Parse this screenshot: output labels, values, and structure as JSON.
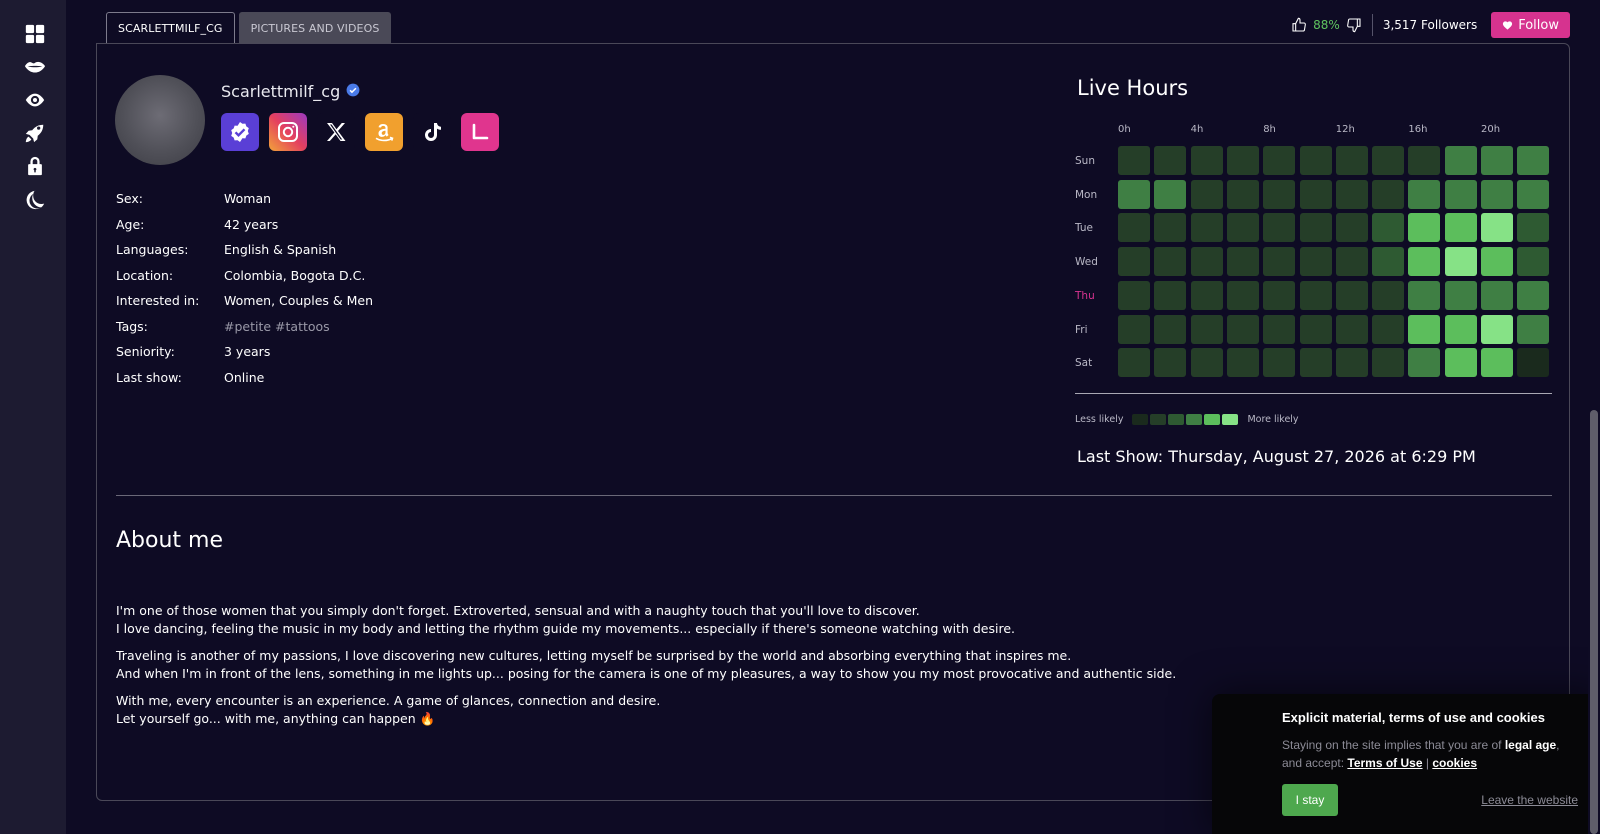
{
  "sidebar": {
    "items": [
      {
        "icon": "grid-icon"
      },
      {
        "icon": "lips-icon"
      },
      {
        "icon": "eye-icon"
      },
      {
        "icon": "rocket-icon"
      },
      {
        "icon": "lock-icon"
      },
      {
        "icon": "moon-icon"
      }
    ]
  },
  "tabs": [
    {
      "label": "SCARLETTMILF_CG",
      "active": true
    },
    {
      "label": "PICTURES AND VIDEOS",
      "active": false
    }
  ],
  "header": {
    "rating": "88%",
    "followers": "3,517 Followers",
    "follow_label": "Follow"
  },
  "profile": {
    "username": "Scarlettmilf_cg",
    "socials": [
      "verified-icon",
      "instagram-icon",
      "x-icon",
      "amazon-icon",
      "tiktok-icon",
      "l-icon"
    ],
    "info": [
      {
        "label": "Sex:",
        "value": "Woman"
      },
      {
        "label": "Age:",
        "value": "42 years"
      },
      {
        "label": "Languages:",
        "value": "English & Spanish"
      },
      {
        "label": "Location:",
        "value": "Colombia, Bogota D.C."
      },
      {
        "label": "Interested in:",
        "value": "Women, Couples & Men"
      },
      {
        "label": "Tags:",
        "value": "#petite #tattoos"
      },
      {
        "label": "Seniority:",
        "value": "3 years"
      },
      {
        "label": "Last show:",
        "value": "Online"
      }
    ]
  },
  "live_hours": {
    "title": "Live Hours",
    "hour_labels": [
      "0h",
      "4h",
      "8h",
      "12h",
      "16h",
      "20h"
    ],
    "days": [
      "Sun",
      "Mon",
      "Tue",
      "Wed",
      "Thu",
      "Fri",
      "Sat"
    ],
    "today": "Thu",
    "levels": [
      [
        1,
        1,
        1,
        1,
        1,
        1,
        1,
        1,
        1,
        3,
        3,
        3
      ],
      [
        3,
        3,
        1,
        1,
        1,
        1,
        1,
        1,
        3,
        3,
        3,
        3
      ],
      [
        1,
        1,
        1,
        1,
        1,
        1,
        1,
        2,
        4,
        4,
        5,
        2
      ],
      [
        1,
        1,
        1,
        1,
        1,
        1,
        1,
        2,
        4,
        5,
        4,
        2
      ],
      [
        1,
        1,
        1,
        1,
        1,
        1,
        1,
        1,
        3,
        3,
        3,
        3
      ],
      [
        1,
        1,
        1,
        1,
        1,
        1,
        1,
        1,
        4,
        4,
        5,
        3
      ],
      [
        1,
        1,
        1,
        1,
        1,
        1,
        1,
        1,
        3,
        4,
        4,
        0
      ]
    ],
    "level_colors": [
      "#1a2a1d",
      "#253e28",
      "#2e5a32",
      "#3f7f44",
      "#5cbe5c",
      "#86e286"
    ],
    "legend_less": "Less likely",
    "legend_more": "More likely",
    "last_show": "Last Show: Thursday, August 27, 2026 at 6:29 PM"
  },
  "about": {
    "title": "About me",
    "paragraphs": [
      [
        "I'm one of those women that you simply don't forget. Extroverted, sensual and with a naughty touch that you'll love to discover.",
        "I love dancing, feeling the music in my body and letting the rhythm guide my movements... especially if there's someone watching with desire."
      ],
      [
        "Traveling is another of my passions, I love discovering new cultures, letting myself be surprised by the world and absorbing everything that inspires me.",
        "And when I'm in front of the lens, something in me lights up... posing for the camera is one of my pleasures, a way to show you my most provocative and authentic side."
      ],
      [
        "With me, every encounter is an experience. A game of glances, connection and desire.",
        "Let yourself go... with me, anything can happen 🔥"
      ]
    ]
  },
  "cookie": {
    "title": "Explicit material, terms of use and cookies",
    "text_1": "Staying on the site implies that you are of",
    "legal_age": "legal age",
    "text_2": ", and accept:",
    "terms_link": "Terms of Use",
    "separator": "|",
    "cookies_link": "cookies",
    "stay_label": "I stay",
    "leave_label": "Leave the website"
  }
}
